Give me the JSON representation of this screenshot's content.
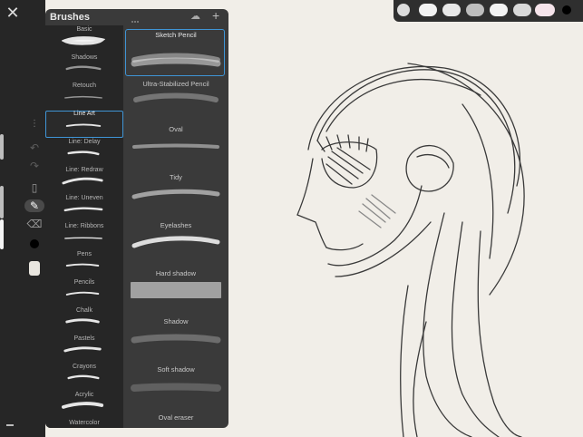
{
  "app": {
    "close_label": "✕"
  },
  "panel": {
    "title": "Brushes",
    "import_icon": "cloud-download-icon",
    "add_icon": "plus-icon",
    "add_label": "+"
  },
  "categories": [
    {
      "label": "Basic"
    },
    {
      "label": "Shadows"
    },
    {
      "label": "Retouch"
    },
    {
      "label": "Line Art"
    },
    {
      "label": "Line: Delay"
    },
    {
      "label": "Line: Redraw"
    },
    {
      "label": "Line: Uneven"
    },
    {
      "label": "Line: Ribbons"
    },
    {
      "label": "Pens"
    },
    {
      "label": "Pencils"
    },
    {
      "label": "Chalk"
    },
    {
      "label": "Pastels"
    },
    {
      "label": "Crayons"
    },
    {
      "label": "Acrylic"
    },
    {
      "label": "Watercolor"
    }
  ],
  "selected_category": "Line Art",
  "brushes": [
    {
      "name": "Sketch Pencil"
    },
    {
      "name": "Ultra-Stabilized Pencil"
    },
    {
      "name": "Oval"
    },
    {
      "name": "Tidy"
    },
    {
      "name": "Eyelashes"
    },
    {
      "name": "Hard shadow"
    },
    {
      "name": "Shadow"
    },
    {
      "name": "Soft shadow"
    },
    {
      "name": "Oval eraser"
    }
  ],
  "selected_brush": "Sketch Pencil",
  "tools": {
    "undo_icon": "undo-icon",
    "redo_icon": "redo-icon",
    "layers_icon": "layers-icon",
    "brush_icon": "brush-icon",
    "eraser_icon": "eraser-icon",
    "color": "#000000"
  },
  "colors": {
    "accent": "#3f95d6",
    "panel": "#3a3a3a",
    "canvas": "#f1eee8"
  }
}
